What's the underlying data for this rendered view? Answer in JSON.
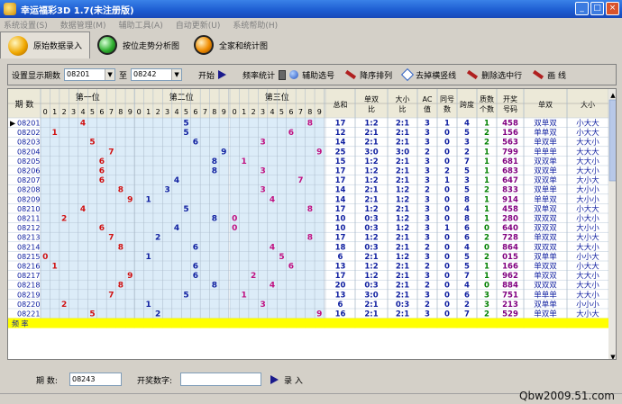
{
  "window": {
    "title": "幸运福彩3D 1.7(未注册版)",
    "min": "_",
    "max": "□",
    "close": "×"
  },
  "menu": [
    "系统设置(S)",
    "数据管理(M)",
    "辅助工具(A)",
    "自动更新(U)",
    "系统帮助(H)"
  ],
  "toolbar": [
    {
      "label": "原始数据录入",
      "icon": "yellow-ball-icon"
    },
    {
      "label": "按位走势分析图",
      "icon": "green-ball-icon"
    },
    {
      "label": "全家和统计图",
      "icon": "orange-ball-icon"
    }
  ],
  "filter": {
    "period_label": "设置显示期数",
    "from": "08201",
    "to_label": "至",
    "to": "08242",
    "start": "开始",
    "freq": "频率统计",
    "assist": "辅助选号",
    "sort": "降序排列",
    "remove_lines": "去掉横竖线",
    "delete_row": "删除选中行",
    "draw_line": "画 线"
  },
  "table": {
    "headers": {
      "period": "期 数",
      "pos1": "第一位",
      "pos2": "第二位",
      "pos3": "第三位",
      "digits": [
        "0",
        "1",
        "2",
        "3",
        "4",
        "5",
        "6",
        "7",
        "8",
        "9"
      ],
      "sum": "总和",
      "odd_even_ratio": "单双比",
      "big_small_ratio": "大小比",
      "ac": "AC值",
      "same_tail": "同号数",
      "span": "跨度",
      "prime_count": "质数个数",
      "draw_no": "开奖号码",
      "odd_even": "单双",
      "big_small": "大小"
    },
    "rows": [
      [
        "08201",
        4,
        5,
        8,
        17,
        "1:2",
        "2:1",
        3,
        1,
        4,
        1,
        "458",
        "双单双",
        "小大大"
      ],
      [
        "08202",
        1,
        5,
        6,
        12,
        "2:1",
        "2:1",
        3,
        0,
        5,
        2,
        "156",
        "单单双",
        "小大大"
      ],
      [
        "08203",
        5,
        6,
        3,
        14,
        "2:1",
        "2:1",
        3,
        0,
        3,
        2,
        "563",
        "单双单",
        "大大小"
      ],
      [
        "08204",
        7,
        9,
        9,
        25,
        "3:0",
        "3:0",
        2,
        0,
        2,
        1,
        "799",
        "单单单",
        "大大大"
      ],
      [
        "08205",
        6,
        8,
        1,
        15,
        "1:2",
        "2:1",
        3,
        0,
        7,
        1,
        "681",
        "双双单",
        "大大小"
      ],
      [
        "08206",
        6,
        8,
        3,
        17,
        "1:2",
        "2:1",
        3,
        2,
        5,
        1,
        "683",
        "双双单",
        "大大小"
      ],
      [
        "08207",
        6,
        4,
        7,
        17,
        "1:2",
        "2:1",
        3,
        1,
        3,
        1,
        "647",
        "双双单",
        "大小大"
      ],
      [
        "08208",
        8,
        3,
        3,
        14,
        "2:1",
        "1:2",
        2,
        0,
        5,
        2,
        "833",
        "双单单",
        "大小小"
      ],
      [
        "08209",
        9,
        1,
        4,
        14,
        "2:1",
        "1:2",
        3,
        0,
        8,
        1,
        "914",
        "单单双",
        "大小小"
      ],
      [
        "08210",
        4,
        5,
        8,
        17,
        "1:2",
        "2:1",
        3,
        0,
        4,
        1,
        "458",
        "双单双",
        "小大大"
      ],
      [
        "08211",
        2,
        8,
        0,
        10,
        "0:3",
        "1:2",
        3,
        0,
        8,
        1,
        "280",
        "双双双",
        "小大小"
      ],
      [
        "08212",
        6,
        4,
        0,
        10,
        "0:3",
        "1:2",
        3,
        1,
        6,
        0,
        "640",
        "双双双",
        "大小小"
      ],
      [
        "08213",
        7,
        2,
        8,
        17,
        "1:2",
        "2:1",
        3,
        0,
        6,
        2,
        "728",
        "单双双",
        "大小大"
      ],
      [
        "08214",
        8,
        6,
        4,
        18,
        "0:3",
        "2:1",
        2,
        0,
        4,
        0,
        "864",
        "双双双",
        "大大小"
      ],
      [
        "08215",
        0,
        1,
        5,
        6,
        "2:1",
        "1:2",
        3,
        0,
        5,
        2,
        "015",
        "双单单",
        "小小大"
      ],
      [
        "08216",
        1,
        6,
        6,
        13,
        "1:2",
        "2:1",
        2,
        0,
        5,
        1,
        "166",
        "单双双",
        "小大大"
      ],
      [
        "08217",
        9,
        6,
        2,
        17,
        "1:2",
        "2:1",
        3,
        0,
        7,
        1,
        "962",
        "单双双",
        "大大小"
      ],
      [
        "08218",
        8,
        8,
        4,
        20,
        "0:3",
        "2:1",
        2,
        0,
        4,
        0,
        "884",
        "双双双",
        "大大小"
      ],
      [
        "08219",
        7,
        5,
        1,
        13,
        "3:0",
        "2:1",
        3,
        0,
        6,
        3,
        "751",
        "单单单",
        "大大小"
      ],
      [
        "08220",
        2,
        1,
        3,
        6,
        "2:1",
        "0:3",
        2,
        0,
        2,
        3,
        "213",
        "双单单",
        "小小小"
      ],
      [
        "08221",
        5,
        2,
        9,
        16,
        "2:1",
        "2:1",
        3,
        0,
        7,
        2,
        "529",
        "单双单",
        "大小大"
      ]
    ],
    "freq_label": "频 率"
  },
  "bottom": {
    "period_label": "期  数:",
    "period_value": "08243",
    "draw_label": "开奖数字:",
    "draw_value": "",
    "enter": "录  入"
  },
  "watermark": "Qbw2009.51.com",
  "colors": {
    "red": "#d01010",
    "blue": "#1020a0",
    "magenta": "#c01080",
    "green": "#008000",
    "purple": "#800080",
    "yellow": "#ffff00",
    "shade": "#dcecf8"
  }
}
